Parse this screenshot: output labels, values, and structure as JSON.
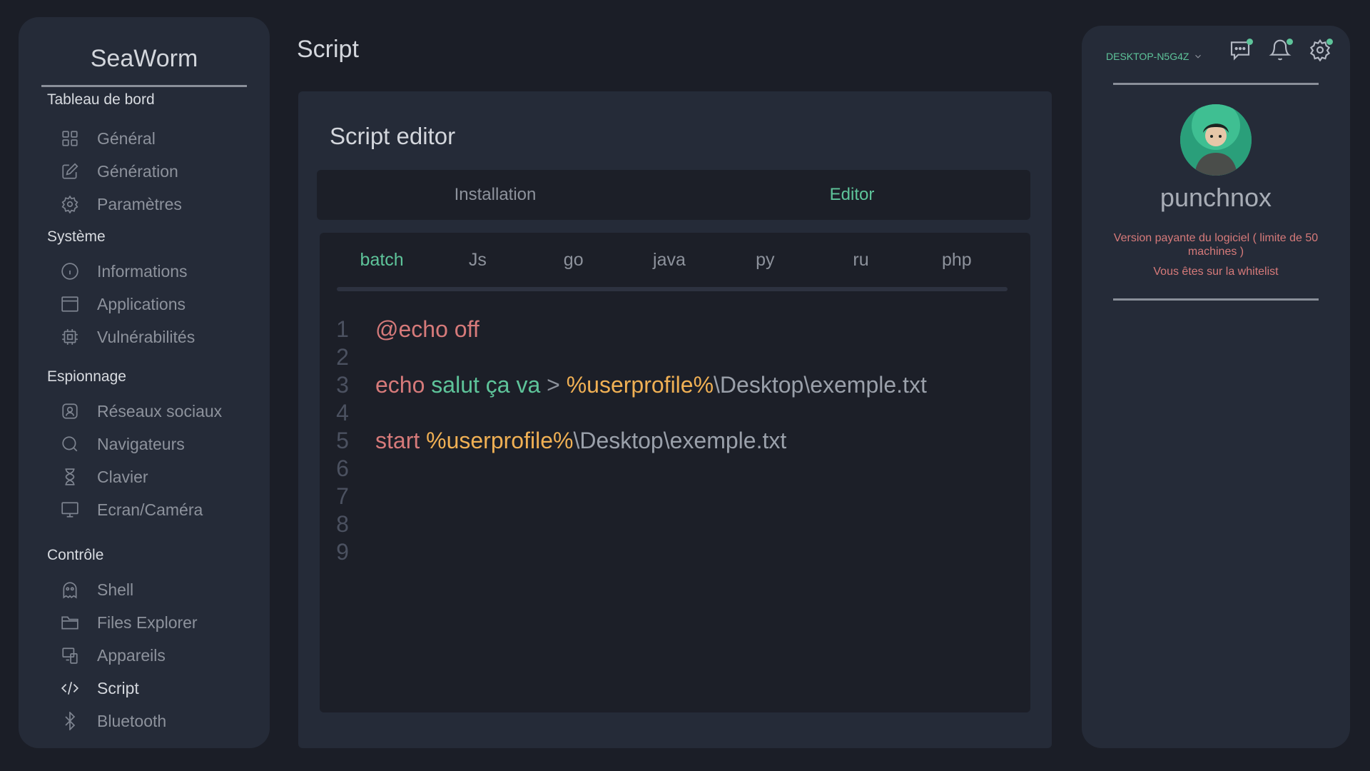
{
  "app": {
    "brand": "SeaWorm",
    "page_title": "Script"
  },
  "sidebar": {
    "sections": [
      {
        "title": "Tableau de bord"
      },
      {
        "title": "Système"
      },
      {
        "title": "Espionnage"
      },
      {
        "title": "Contrôle"
      }
    ],
    "items": [
      {
        "label": "Général",
        "icon": "grid-icon"
      },
      {
        "label": "Génération",
        "icon": "edit-icon"
      },
      {
        "label": "Paramètres",
        "icon": "gear-icon"
      },
      {
        "label": "Informations",
        "icon": "info-icon"
      },
      {
        "label": "Applications",
        "icon": "window-icon"
      },
      {
        "label": "Vulnérabilités",
        "icon": "chip-icon"
      },
      {
        "label": "Réseaux sociaux",
        "icon": "user-badge-icon"
      },
      {
        "label": "Navigateurs",
        "icon": "search-icon"
      },
      {
        "label": "Clavier",
        "icon": "hourglass-icon"
      },
      {
        "label": "Ecran/Caméra",
        "icon": "monitor-icon"
      },
      {
        "label": "Shell",
        "icon": "ghost-icon"
      },
      {
        "label": "Files Explorer",
        "icon": "folder-icon"
      },
      {
        "label": "Appareils",
        "icon": "devices-icon"
      },
      {
        "label": "Script",
        "icon": "code-icon"
      },
      {
        "label": "Bluetooth",
        "icon": "bluetooth-icon"
      }
    ]
  },
  "main": {
    "title": "Script editor",
    "tabs": [
      {
        "label": "Installation"
      },
      {
        "label": "Editor"
      }
    ],
    "active_tab": "Editor",
    "languages": [
      "batch",
      "Js",
      "go",
      "java",
      "py",
      "ru",
      "php"
    ],
    "active_language": "batch",
    "line_numbers": [
      "1",
      "2",
      "3",
      "4",
      "5",
      "6",
      "7",
      "8",
      "9"
    ],
    "code": {
      "line1_kw": "@echo off",
      "line3_kw": "echo",
      "line3_str": "salut ça va",
      "line3_op": ">",
      "line3_var": "%userprofile%",
      "line3_path": "\\Desktop\\exemple.txt",
      "line5_kw": "start",
      "line5_var": "%userprofile%",
      "line5_path": "\\Desktop\\exemple.txt"
    }
  },
  "right": {
    "machine": "DESKTOP-N5G4Z",
    "username": "punchnox",
    "license": "Version payante du logiciel ( limite de 50 machines )",
    "whitelist": "Vous êtes sur la whitelist"
  },
  "colors": {
    "accent": "#5ec49a",
    "keyword": "#d67a7a",
    "variable": "#f0b054",
    "background": "#1b1e27",
    "panel": "#252b38"
  }
}
